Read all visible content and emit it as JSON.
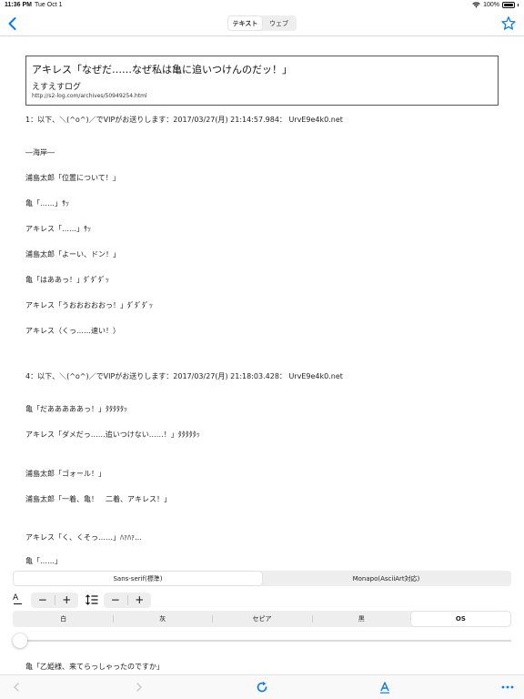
{
  "status": {
    "time": "11:36 PM",
    "date": "Tue Oct 1",
    "battery": "100%"
  },
  "nav": {
    "segments": [
      {
        "label": "テキスト",
        "active": true
      },
      {
        "label": "ウェブ",
        "active": false
      }
    ]
  },
  "card": {
    "title": "アキレス「なぜだ……なぜ私は亀に追いつけんのだッ！」",
    "blog": "えすえすログ",
    "url": "http://s2-log.com/archives/50949254.html"
  },
  "lines": [
    "1：以下、＼(^o^)／でVIPがお送りします：2017/03/27(月) 21:14:57.984： UrvE9e4k0.net",
    "―海岸―",
    "浦島太郎「位置について！」",
    "亀「……」ｻｯ",
    "アキレス「……」ｻｯ",
    "浦島太郎「よーい、ドン！」",
    "亀「はああっ！」ﾀﾞﾀﾞﾀﾞｯ",
    "アキレス「うおおおおおっ！」ﾀﾞﾀﾞﾀﾞｯ",
    "アキレス（くっ……速い！）",
    "4：以下、＼(^o^)／でVIPがお送りします：2017/03/27(月) 21:18:03.428： UrvE9e4k0.net",
    "亀「だあああああっ！」ﾀﾀﾀﾀﾀｯ",
    "アキレス「ダメだっ……追いつけない……！」ﾀﾀﾀﾀﾀｯ",
    "浦島太郎「ゴォール！」",
    "浦島太郎「一着、亀！　二着、アキレス！」",
    "アキレス「く、くそっ……」ﾊｧﾊｧ…",
    "亀「……」"
  ],
  "settings": {
    "fonts": [
      {
        "label": "Sans-serif(標準)",
        "active": true
      },
      {
        "label": "Monapo(AsciiArt対応)",
        "active": false
      }
    ],
    "minus": "−",
    "plus": "+",
    "colors": [
      {
        "label": "白",
        "active": false
      },
      {
        "label": "灰",
        "active": false
      },
      {
        "label": "セピア",
        "active": false
      },
      {
        "label": "黒",
        "active": false
      },
      {
        "label": "OS",
        "active": true
      }
    ],
    "brightness": 0.0,
    "next_line": "亀「乙姫様、来てらっしゃったのですか」"
  },
  "colors": {
    "accent": "#007aff",
    "segment_bg": "#eeeeef"
  }
}
